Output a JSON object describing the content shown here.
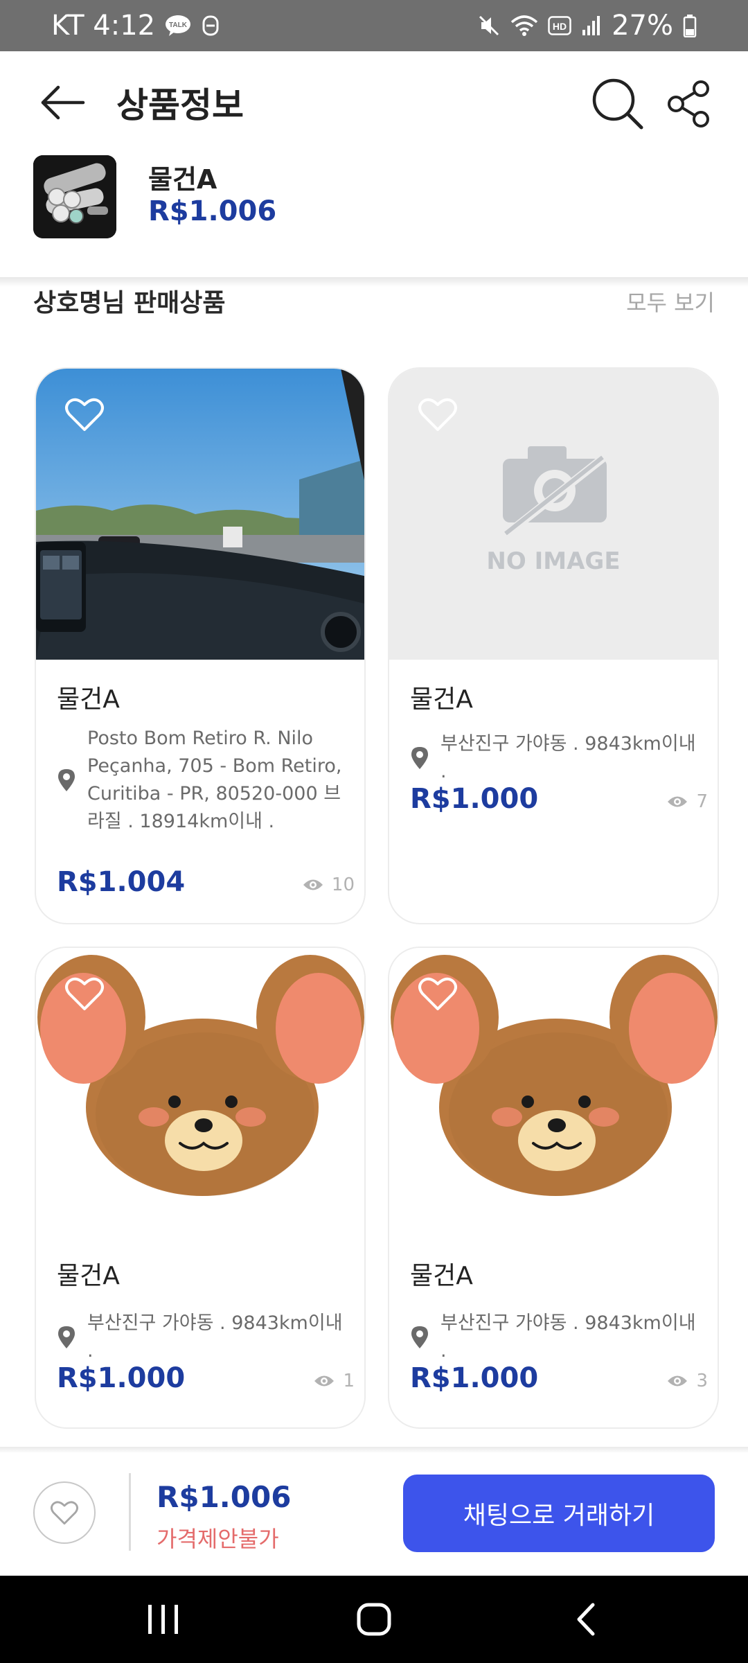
{
  "status_bar": {
    "carrier_time": "KT 4:12",
    "battery": "27%"
  },
  "header": {
    "title": "상품정보"
  },
  "product": {
    "name": "물건A",
    "price": "R$1.006"
  },
  "section": {
    "title": "상호명님 판매상품",
    "view_all": "모두 보기"
  },
  "cards": [
    {
      "name": "물건A",
      "location": "Posto Bom Retiro R. Nilo Peçanha, 705 - Bom Retiro, Curitiba - PR, 80520-000 브라질 . 18914km이내 .",
      "price": "R$1.004",
      "views": "10"
    },
    {
      "name": "물건A",
      "location": "부산진구 가야동 . 9843km이내 .",
      "price": "R$1.000",
      "views": "7",
      "no_image": "NO IMAGE"
    },
    {
      "name": "물건A",
      "location": "부산진구 가야동 . 9843km이내 .",
      "price": "R$1.000",
      "views": "1"
    },
    {
      "name": "물건A",
      "location": "부산진구 가야동 . 9843km이내 .",
      "price": "R$1.000",
      "views": "3"
    }
  ],
  "bottom_bar": {
    "price": "R$1.006",
    "negotiation": "가격제안불가",
    "chat_button": "채팅으로 거래하기"
  },
  "colors": {
    "accent": "#3d54eb",
    "price": "#1d3c9f",
    "warning": "#e46b6b"
  }
}
